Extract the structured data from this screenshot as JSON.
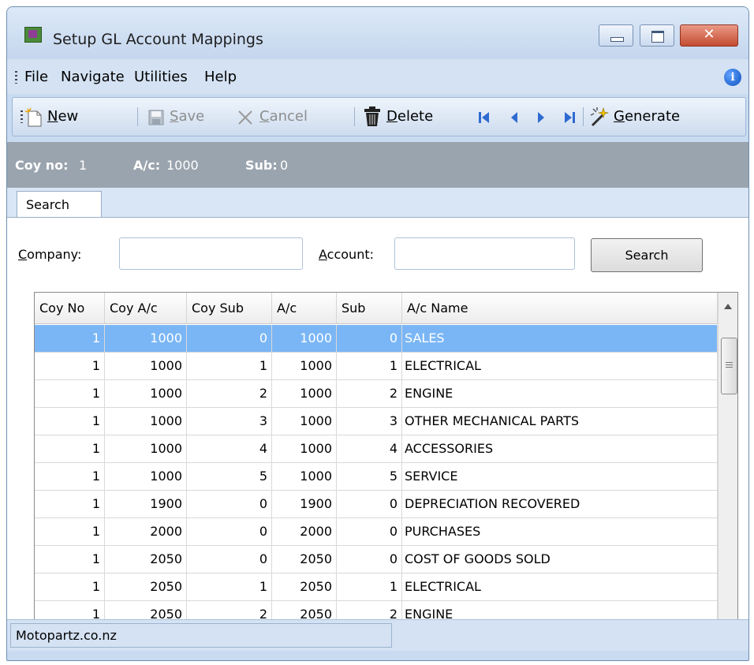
{
  "window": {
    "title": "Setup GL Account Mappings",
    "close_glyph": "✕"
  },
  "menu": [
    {
      "label": "File"
    },
    {
      "label": "Navigate"
    },
    {
      "label": "Utilities"
    },
    {
      "label": "Help"
    }
  ],
  "toolbar": {
    "new": {
      "accel": "N",
      "rest": "ew"
    },
    "save": {
      "accel": "S",
      "rest": "ave"
    },
    "cancel": {
      "accel": "C",
      "rest": "ancel"
    },
    "delete": {
      "accel": "D",
      "rest": "elete"
    },
    "generate": {
      "accel": "G",
      "rest": "enerate"
    }
  },
  "header": {
    "coy_label": "Coy no:",
    "coy_value": "1",
    "ac_label": "A/c:",
    "ac_value": "1000",
    "sub_label": "Sub:",
    "sub_value": "0"
  },
  "tab": {
    "label": "Search"
  },
  "search": {
    "company_accel": "C",
    "company_rest": "ompany:",
    "account_accel": "A",
    "account_rest": "ccount:",
    "company_value": "",
    "account_value": "",
    "button_label": "Search"
  },
  "grid": {
    "columns": [
      "Coy No",
      "Coy A/c",
      "Coy Sub",
      "A/c",
      "Sub",
      "A/c Name"
    ],
    "rows": [
      [
        "1",
        "1000",
        "0",
        "1000",
        "0",
        "SALES"
      ],
      [
        "1",
        "1000",
        "1",
        "1000",
        "1",
        "ELECTRICAL"
      ],
      [
        "1",
        "1000",
        "2",
        "1000",
        "2",
        "ENGINE"
      ],
      [
        "1",
        "1000",
        "3",
        "1000",
        "3",
        "OTHER MECHANICAL PARTS"
      ],
      [
        "1",
        "1000",
        "4",
        "1000",
        "4",
        "ACCESSORIES"
      ],
      [
        "1",
        "1000",
        "5",
        "1000",
        "5",
        "SERVICE"
      ],
      [
        "1",
        "1900",
        "0",
        "1900",
        "0",
        "DEPRECIATION RECOVERED"
      ],
      [
        "1",
        "2000",
        "0",
        "2000",
        "0",
        "PURCHASES"
      ],
      [
        "1",
        "2050",
        "0",
        "2050",
        "0",
        "COST OF GOODS SOLD"
      ],
      [
        "1",
        "2050",
        "1",
        "2050",
        "1",
        "ELECTRICAL"
      ],
      [
        "1",
        "2050",
        "2",
        "2050",
        "2",
        "ENGINE"
      ]
    ],
    "selected_row": 0,
    "selected_color": "#7ab6f5"
  },
  "status": {
    "text": "Motopartz.co.nz"
  }
}
